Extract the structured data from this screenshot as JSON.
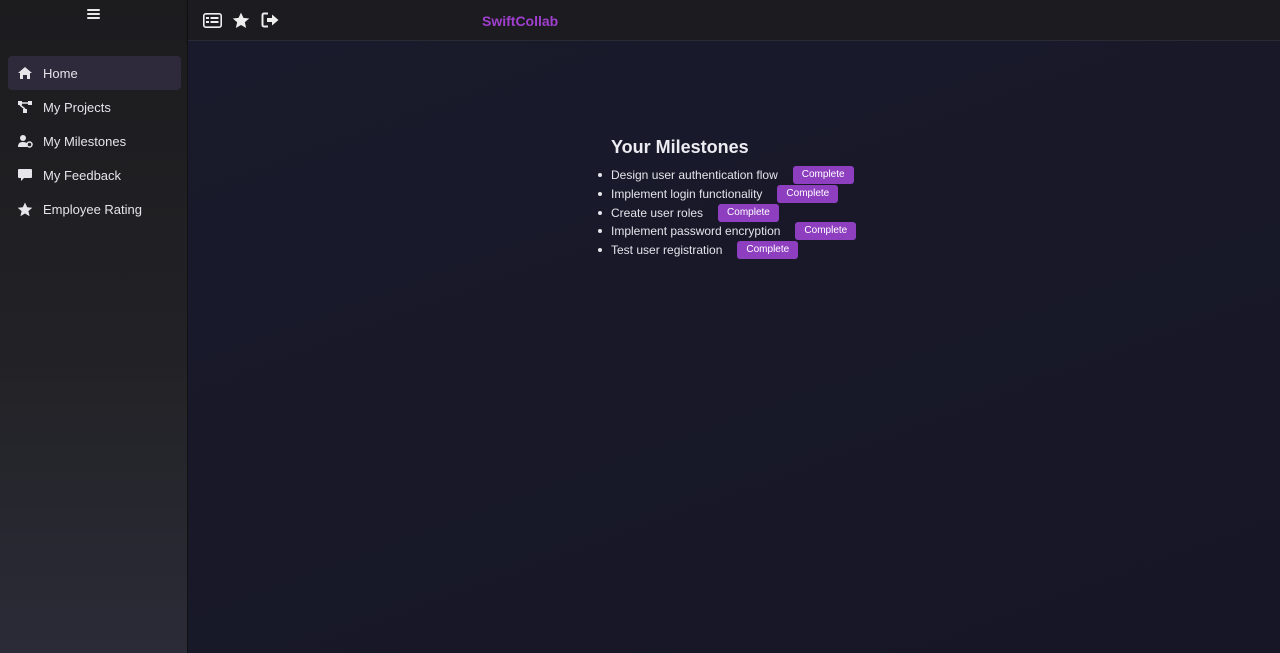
{
  "app": {
    "brand": "SwiftCollab"
  },
  "sidebar": {
    "menu_icon": "hamburger-menu-icon",
    "items": [
      {
        "label": "Home",
        "icon": "home-icon",
        "active": true
      },
      {
        "label": "My Projects",
        "icon": "project-diagram-icon",
        "active": false
      },
      {
        "label": "My Milestones",
        "icon": "user-gear-icon",
        "active": false
      },
      {
        "label": "My Feedback",
        "icon": "comment-icon",
        "active": false
      },
      {
        "label": "Employee Rating",
        "icon": "star-icon",
        "active": false
      }
    ]
  },
  "topbar": {
    "icons": [
      "list-icon",
      "star-icon",
      "sign-out-icon"
    ]
  },
  "main": {
    "heading": "Your Milestones",
    "milestones": [
      {
        "name": "Design user authentication flow",
        "action": "Complete"
      },
      {
        "name": "Implement login functionality",
        "action": "Complete"
      },
      {
        "name": "Create user roles",
        "action": "Complete"
      },
      {
        "name": "Implement password encryption",
        "action": "Complete"
      },
      {
        "name": "Test user registration",
        "action": "Complete"
      }
    ]
  },
  "colors": {
    "accent": "#8e3fc0",
    "brand": "#a13fcf",
    "background": "#17172a",
    "sidebar": "#1f1f23"
  }
}
